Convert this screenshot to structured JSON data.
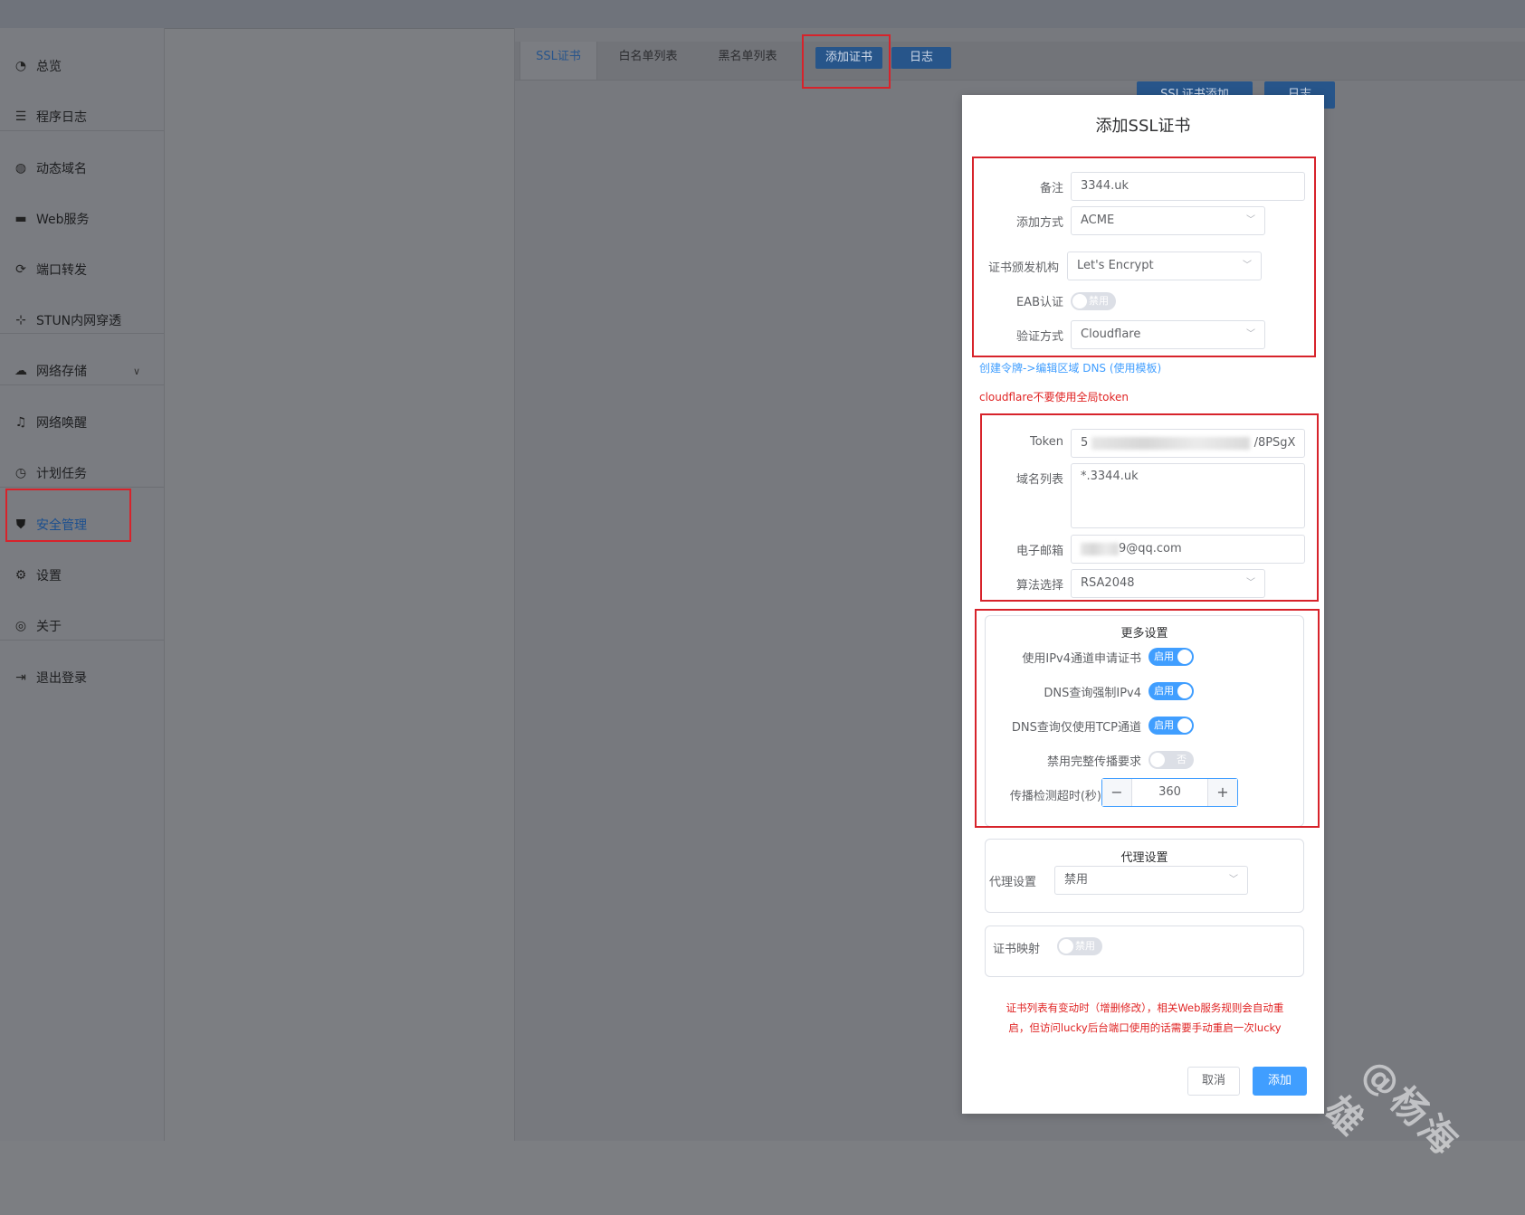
{
  "sidebar": {
    "items": [
      {
        "label": "总览",
        "icon": "dashboard-icon"
      },
      {
        "label": "程序日志",
        "icon": "log-icon"
      },
      {
        "label": "动态域名",
        "icon": "ddns-icon"
      },
      {
        "label": "Web服务",
        "icon": "web-icon"
      },
      {
        "label": "端口转发",
        "icon": "port-forward-icon"
      },
      {
        "label": "STUN内网穿透",
        "icon": "stun-icon"
      },
      {
        "label": "网络存储",
        "icon": "cloud-icon"
      },
      {
        "label": "网络唤醒",
        "icon": "bell-icon"
      },
      {
        "label": "计划任务",
        "icon": "clock-icon"
      },
      {
        "label": "安全管理",
        "icon": "shield-icon"
      },
      {
        "label": "设置",
        "icon": "gear-icon"
      },
      {
        "label": "关于",
        "icon": "about-icon"
      },
      {
        "label": "退出登录",
        "icon": "logout-icon"
      }
    ],
    "active": "安全管理"
  },
  "tabs": [
    {
      "label": "SSL证书"
    },
    {
      "label": "白名单列表"
    },
    {
      "label": "黑名单列表"
    }
  ],
  "tab_buttons": [
    {
      "label": "添加证书"
    },
    {
      "label": "日志"
    }
  ],
  "bg_buttons": [
    {
      "label": "SSL证书添加"
    },
    {
      "label": "日志"
    }
  ],
  "dialog": {
    "title": "添加SSL证书",
    "remark": {
      "label": "备注",
      "value": "3344.uk"
    },
    "add_method": {
      "label": "添加方式",
      "value": "ACME"
    },
    "ca": {
      "label": "证书颁发机构",
      "value": "Let's Encrypt"
    },
    "eab": {
      "label": "EAB认证",
      "state": "禁用"
    },
    "verify": {
      "label": "验证方式",
      "value": "Cloudflare"
    },
    "hint_link": "创建令牌->编辑区域 DNS (使用模板)",
    "hint_red": "cloudflare不要使用全局token",
    "token": {
      "label": "Token",
      "prefix": "5",
      "suffix": "/8PSgX"
    },
    "domains": {
      "label": "域名列表",
      "value": "*.3344.uk"
    },
    "email": {
      "label": "电子邮箱",
      "suffix": "9@qq.com"
    },
    "algo": {
      "label": "算法选择",
      "value": "RSA2048"
    },
    "more": {
      "title": "更多设置",
      "ipv4_channel": {
        "label": "使用IPv4通道申请证书",
        "state": "启用"
      },
      "dns_ipv4": {
        "label": "DNS查询强制IPv4",
        "state": "启用"
      },
      "dns_tcp": {
        "label": "DNS查询仅使用TCP通道",
        "state": "启用"
      },
      "disable_propagation": {
        "label": "禁用完整传播要求",
        "state": "否"
      },
      "timeout": {
        "label": "传播检测超时(秒)",
        "value": "360",
        "minus": "−",
        "plus": "+"
      }
    },
    "proxy": {
      "title": "代理设置",
      "label": "代理设置",
      "value": "禁用"
    },
    "mapping": {
      "label": "证书映射",
      "state": "禁用"
    },
    "notice_line1": "证书列表有变动时（增删修改），相关Web服务规则会自动重",
    "notice_line2": "启，但访问lucky后台端口使用的话需要手动重启一次lucky",
    "cancel": "取消",
    "submit": "添加"
  },
  "watermark": "@杨海雄"
}
